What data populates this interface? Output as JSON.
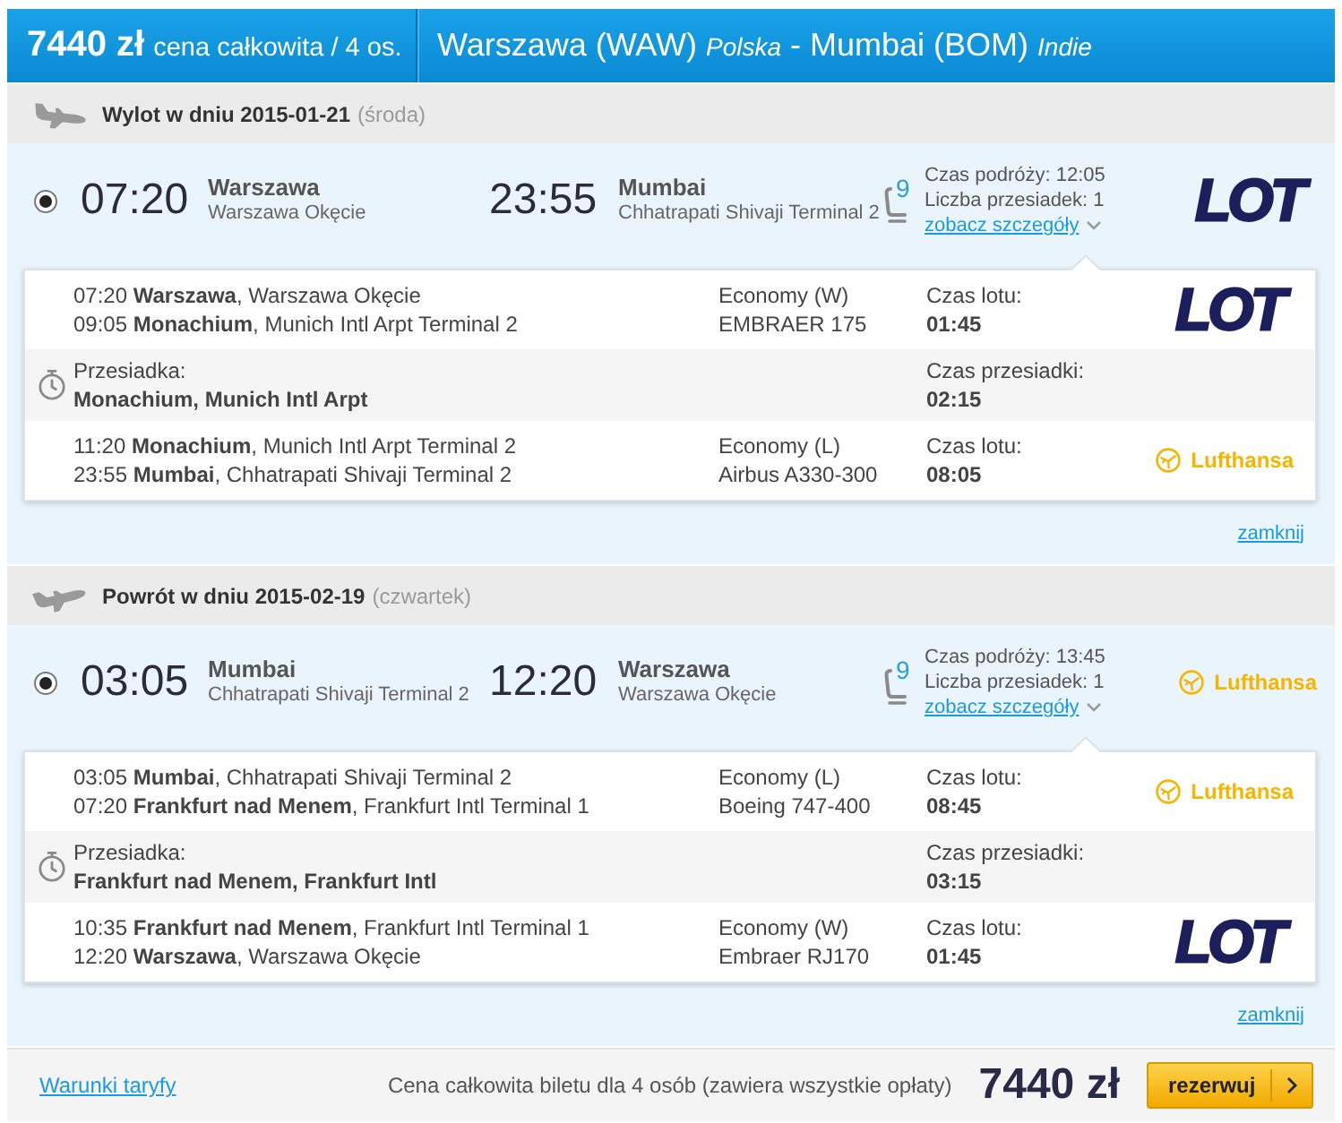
{
  "header": {
    "total_price": "7440 zł",
    "price_note": "cena całkowita / 4 os.",
    "origin": "Warszawa (WAW)",
    "origin_country": "Polska",
    "separator": "-",
    "destination": "Mumbai (BOM)",
    "destination_country": "Indie"
  },
  "journeys": [
    {
      "kind": "outbound",
      "heading": "Wylot w dniu 2015-01-21",
      "weekday": "(środa)",
      "options": [
        {
          "selected": true,
          "depart_time": "07:20",
          "from_city": "Warszawa",
          "from_airport": "Warszawa Okęcie",
          "arrive_time": "23:55",
          "to_city": "Mumbai",
          "to_airport": "Chhatrapati Shivaji Terminal 2",
          "seats_left": "9",
          "travel_time": "Czas podróży: 12:05",
          "stops": "Liczba przesiadek: 1",
          "details_link": "zobacz szczegóły",
          "airline": {
            "kind": "lot",
            "name": "LOT"
          },
          "expanded": true,
          "segments": [
            {
              "kind": "flight",
              "departure": "07:20 **Warszawa**, Warszawa Okęcie",
              "arrival": "09:05 **Monachium**, Munich Intl Arpt Terminal 2",
              "cabin": "Economy (W)",
              "aircraft": "EMBRAER 175",
              "duration_label": "Czas lotu:",
              "duration": "01:45",
              "airline": {
                "kind": "lot",
                "name": "LOT"
              }
            },
            {
              "kind": "layover",
              "label": "Przesiadka:",
              "place": "Monachium, Munich Intl Arpt",
              "duration_label": "Czas przesiadki:",
              "duration": "02:15"
            },
            {
              "kind": "flight",
              "departure": "11:20 **Monachium**, Munich Intl Arpt Terminal 2",
              "arrival": "23:55 **Mumbai**, Chhatrapati Shivaji Terminal 2",
              "cabin": "Economy (L)",
              "aircraft": "Airbus A330-300",
              "duration_label": "Czas lotu:",
              "duration": "08:05",
              "airline": {
                "kind": "lufthansa",
                "name": "Lufthansa"
              }
            }
          ],
          "close_link": "zamknij"
        }
      ]
    },
    {
      "kind": "return",
      "heading": "Powrót w dniu 2015-02-19",
      "weekday": "(czwartek)",
      "options": [
        {
          "selected": true,
          "depart_time": "03:05",
          "from_city": "Mumbai",
          "from_airport": "Chhatrapati Shivaji Terminal 2",
          "arrive_time": "12:20",
          "to_city": "Warszawa",
          "to_airport": "Warszawa Okęcie",
          "seats_left": "9",
          "travel_time": "Czas podróży: 13:45",
          "stops": "Liczba przesiadek: 1",
          "details_link": "zobacz szczegóły",
          "airline": {
            "kind": "lufthansa",
            "name": "Lufthansa"
          },
          "expanded": true,
          "segments": [
            {
              "kind": "flight",
              "departure": "03:05 **Mumbai**, Chhatrapati Shivaji Terminal 2",
              "arrival": "07:20 **Frankfurt nad Menem**, Frankfurt Intl Terminal 1",
              "cabin": "Economy (L)",
              "aircraft": "Boeing 747-400",
              "duration_label": "Czas lotu:",
              "duration": "08:45",
              "airline": {
                "kind": "lufthansa",
                "name": "Lufthansa"
              }
            },
            {
              "kind": "layover",
              "label": "Przesiadka:",
              "place": "Frankfurt nad Menem, Frankfurt Intl",
              "duration_label": "Czas przesiadki:",
              "duration": "03:15"
            },
            {
              "kind": "flight",
              "departure": "10:35 **Frankfurt nad Menem**, Frankfurt Intl Terminal 1",
              "arrival": "12:20 **Warszawa**, Warszawa Okęcie",
              "cabin": "Economy (W)",
              "aircraft": "Embraer RJ170",
              "duration_label": "Czas lotu:",
              "duration": "01:45",
              "airline": {
                "kind": "lot",
                "name": "LOT"
              }
            }
          ],
          "close_link": "zamknij"
        }
      ]
    }
  ],
  "footer": {
    "terms_link": "Warunki taryfy",
    "total_note": "Cena całkowita biletu dla 4 osób (zawiera wszystkie opłaty)",
    "total_price": "7440 zł",
    "book_button": "rezerwuj"
  }
}
